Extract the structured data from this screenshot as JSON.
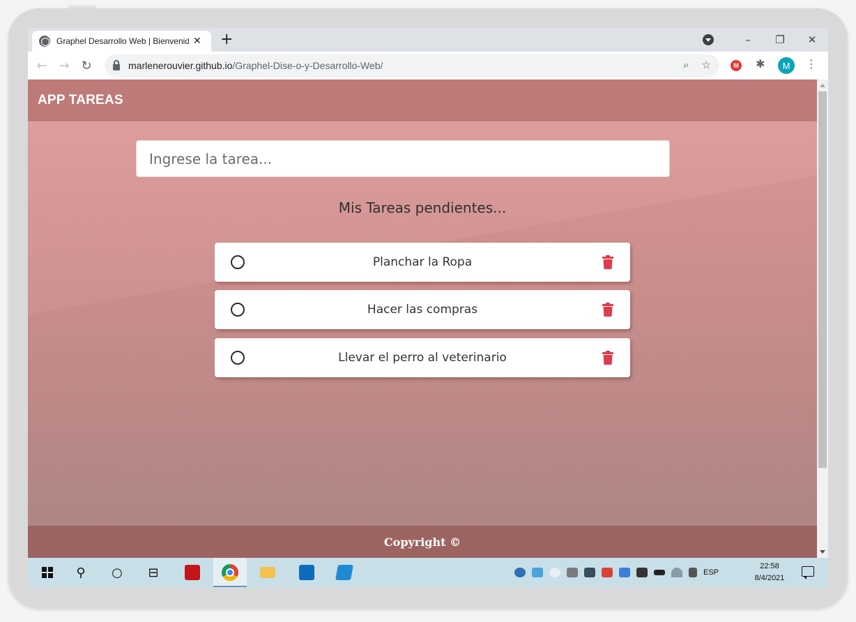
{
  "browser": {
    "tab_title": "Graphel Desarrollo Web | Bienvenido",
    "tab_close": "✕",
    "new_tab": "+",
    "window_controls": {
      "minimize": "–",
      "restore": "❐",
      "close": "✕"
    },
    "nav": {
      "back": "←",
      "forward": "→",
      "reload": "↻"
    },
    "url_host": "marlenerouvier.github.io",
    "url_path": "/Graphel-Dise-o-y-Desarrollo-Web/",
    "zoom_icon": "⌕",
    "star_icon": "☆",
    "extension_badge": "M",
    "profile_initial": "M",
    "menu_icon": "⋮",
    "puzzle_icon": "✱"
  },
  "app": {
    "brand": "APP TAREAS",
    "input_placeholder": "Ingrese la tarea...",
    "section_title": "Mis Tareas pendientes...",
    "tasks": [
      {
        "text": "Planchar la Ropa",
        "done": false
      },
      {
        "text": "Hacer las compras",
        "done": false
      },
      {
        "text": "Llevar el perro al veterinario",
        "done": false
      }
    ],
    "footer": "Copyright ©",
    "colors": {
      "navbar": "#bd7a78",
      "footer": "#9c6461",
      "trash": "#e03a4d"
    }
  },
  "taskbar": {
    "search_icon": "⚲",
    "cortana_icon": "○",
    "taskview_icon": "⊟",
    "language": "ESP",
    "time": "22:58",
    "date": "8/4/2021"
  }
}
